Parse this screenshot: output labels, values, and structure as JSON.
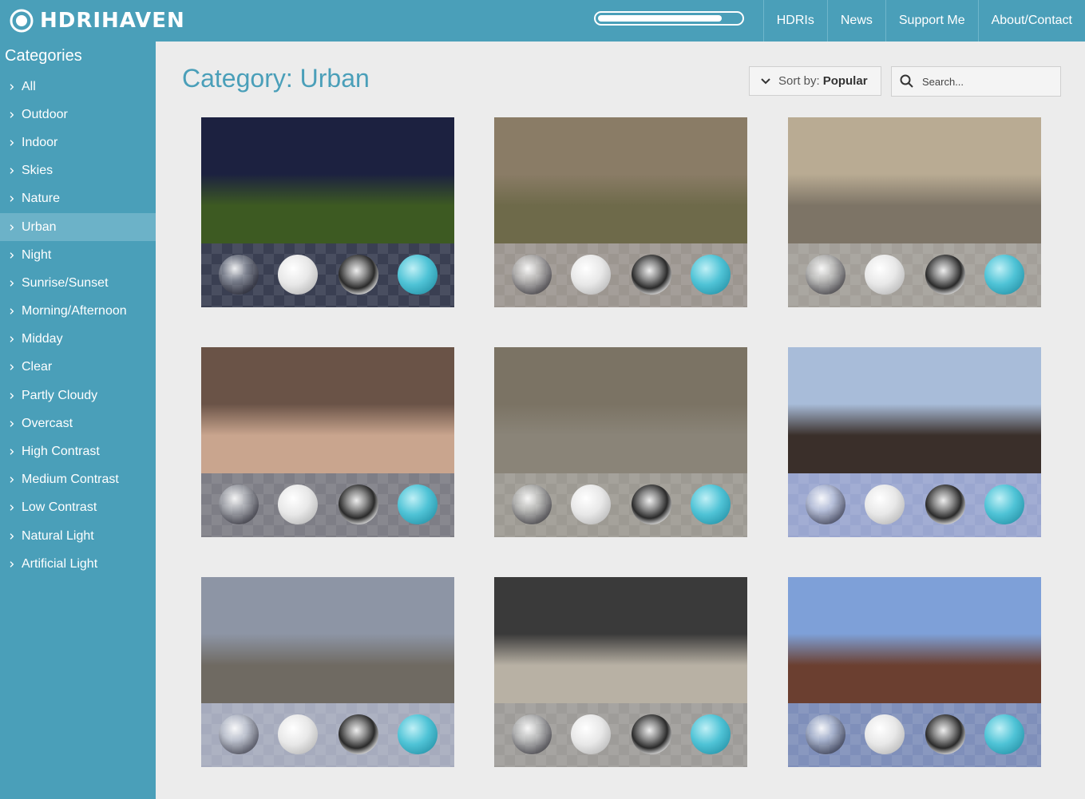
{
  "header": {
    "logo_text": "HDRIHAVEN",
    "progress": 0.87,
    "nav": [
      "HDRIs",
      "News",
      "Support Me",
      "About/Contact"
    ],
    "color": "#4a9fb9"
  },
  "sidebar": {
    "title": "Categories",
    "active": "Urban",
    "items": [
      "All",
      "Outdoor",
      "Indoor",
      "Skies",
      "Nature",
      "Urban",
      "Night",
      "Sunrise/Sunset",
      "Morning/Afternoon",
      "Midday",
      "Clear",
      "Partly Cloudy",
      "Overcast",
      "High Contrast",
      "Medium Contrast",
      "Low Contrast",
      "Natural Light",
      "Artificial Light"
    ]
  },
  "main": {
    "title": "Category: Urban",
    "sort_prefix": "Sort by:",
    "sort_value": "Popular",
    "search_placeholder": "Search..."
  },
  "thumbnails": [
    {
      "scene": "night-field",
      "sky": "#1c2140",
      "ground": "#3d5a22",
      "tray": "#3a3f52"
    },
    {
      "scene": "hotel-room",
      "sky": "#8a7c66",
      "ground": "#6e6a4a",
      "tray": "#9c9690"
    },
    {
      "scene": "cloister",
      "sky": "#b9ab93",
      "ground": "#7d7466",
      "tray": "#a39f99"
    },
    {
      "scene": "graffiti-shelter",
      "sky": "#6a5347",
      "ground": "#c9a58e",
      "tray": "#7e7e86"
    },
    {
      "scene": "train-station-dome",
      "sky": "#7b7364",
      "ground": "#8a8478",
      "tray": "#9d9a93"
    },
    {
      "scene": "forest-pond",
      "sky": "#a8bcd9",
      "ground": "#3a2f2a",
      "tray": "#9aa6cf"
    },
    {
      "scene": "bridge-overcast",
      "sky": "#8d95a5",
      "ground": "#6f6a62",
      "tray": "#a6abbd"
    },
    {
      "scene": "hamburg-station",
      "sky": "#3a3a3a",
      "ground": "#b8b1a4",
      "tray": "#9e9c99"
    },
    {
      "scene": "garden-house",
      "sky": "#7ea0d8",
      "ground": "#6b3f30",
      "tray": "#7f8fba"
    }
  ]
}
